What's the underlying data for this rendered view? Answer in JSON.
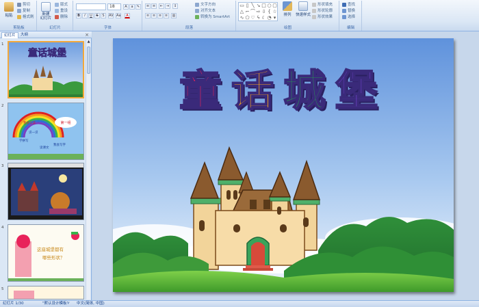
{
  "ribbon": {
    "clipboard": {
      "label": "剪贴板",
      "paste": "粘贴",
      "cut": "剪切",
      "copy": "复制",
      "format_painter": "格式刷"
    },
    "slides": {
      "label": "幻灯片",
      "new_slide": "新建\n幻灯片",
      "layout": "版式",
      "reset": "重设",
      "delete": "删除"
    },
    "font": {
      "label": "字体",
      "font_name": "",
      "font_size": "18"
    },
    "paragraph": {
      "label": "段落",
      "text_direction": "文字方向",
      "align_text": "对齐文本",
      "smartart": "转换为 SmartArt"
    },
    "drawing": {
      "label": "绘图",
      "arrange": "排列",
      "quick_styles": "快速样式",
      "shape_fill": "形状填充",
      "shape_outline": "形状轮廓",
      "shape_effects": "形状效果"
    },
    "editing": {
      "label": "编辑",
      "find": "查找",
      "replace": "替换",
      "select": "选择"
    }
  },
  "pane": {
    "tabs": [
      "幻灯片",
      "大纲"
    ],
    "close": "×",
    "thumbnails": [
      {
        "num": "1",
        "title": "童话城堡"
      },
      {
        "num": "2",
        "texts": [
          "第一组",
          "我会认读",
          "识一识",
          "学拼写",
          "读课文",
          "我会写字"
        ]
      },
      {
        "num": "3"
      },
      {
        "num": "4",
        "texts": [
          "这座城堡都有",
          "哪些形状？"
        ]
      },
      {
        "num": "5"
      }
    ]
  },
  "slide": {
    "title_chars": [
      "童",
      "话",
      "城",
      "堡"
    ],
    "title_colors": [
      "#e8235a",
      "#f7a41c",
      "#22b14c",
      "#6a3fc1"
    ]
  },
  "status": {
    "slide_info": "幻灯片 1/30",
    "theme": "\"默认设计模板\"",
    "language": "中文(简体, 中国)"
  }
}
